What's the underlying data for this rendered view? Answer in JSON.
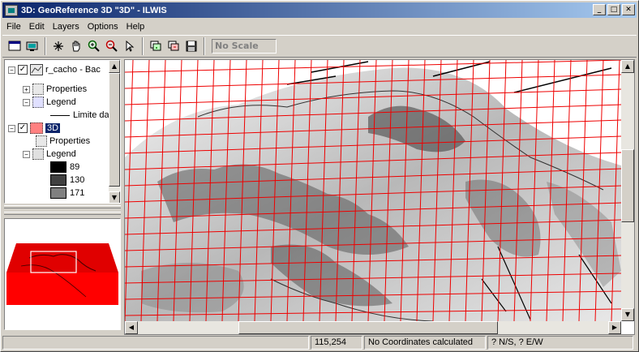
{
  "window": {
    "title": "3D: GeoReference 3D \"3D\" - ILWIS",
    "minimize": "_",
    "maximize": "□",
    "close": "✕"
  },
  "menu": [
    "File",
    "Edit",
    "Layers",
    "Options",
    "Help"
  ],
  "toolbar": {
    "tools": [
      "new-map-icon",
      "open-icon",
      "pan-center-icon",
      "hand-pan-icon",
      "zoom-in-icon",
      "zoom-out-icon",
      "select-pointer-icon",
      "layer-add-icon",
      "layer-remove-icon",
      "save-icon"
    ],
    "scale_label": "No Scale"
  },
  "layers": {
    "layer1": {
      "name": "r_cacho - Bac",
      "checked": true
    },
    "layer1_properties": "Properties",
    "layer1_legend": "Legend",
    "layer1_legend_item": "Limite da",
    "layer2": {
      "name": "3D",
      "checked": true
    },
    "layer2_properties": "Properties",
    "layer2_legend": "Legend",
    "legend_values": [
      {
        "value": "89",
        "color": "#000000"
      },
      {
        "value": "130",
        "color": "#404040"
      },
      {
        "value": "171",
        "color": "#808080"
      }
    ]
  },
  "status": {
    "coords": "115,254",
    "message": "No Coordinates calculated",
    "latlon": "? N/S, ? E/W"
  },
  "colors": {
    "grid": "#ee0000",
    "overview_fill": "#ff0000"
  }
}
